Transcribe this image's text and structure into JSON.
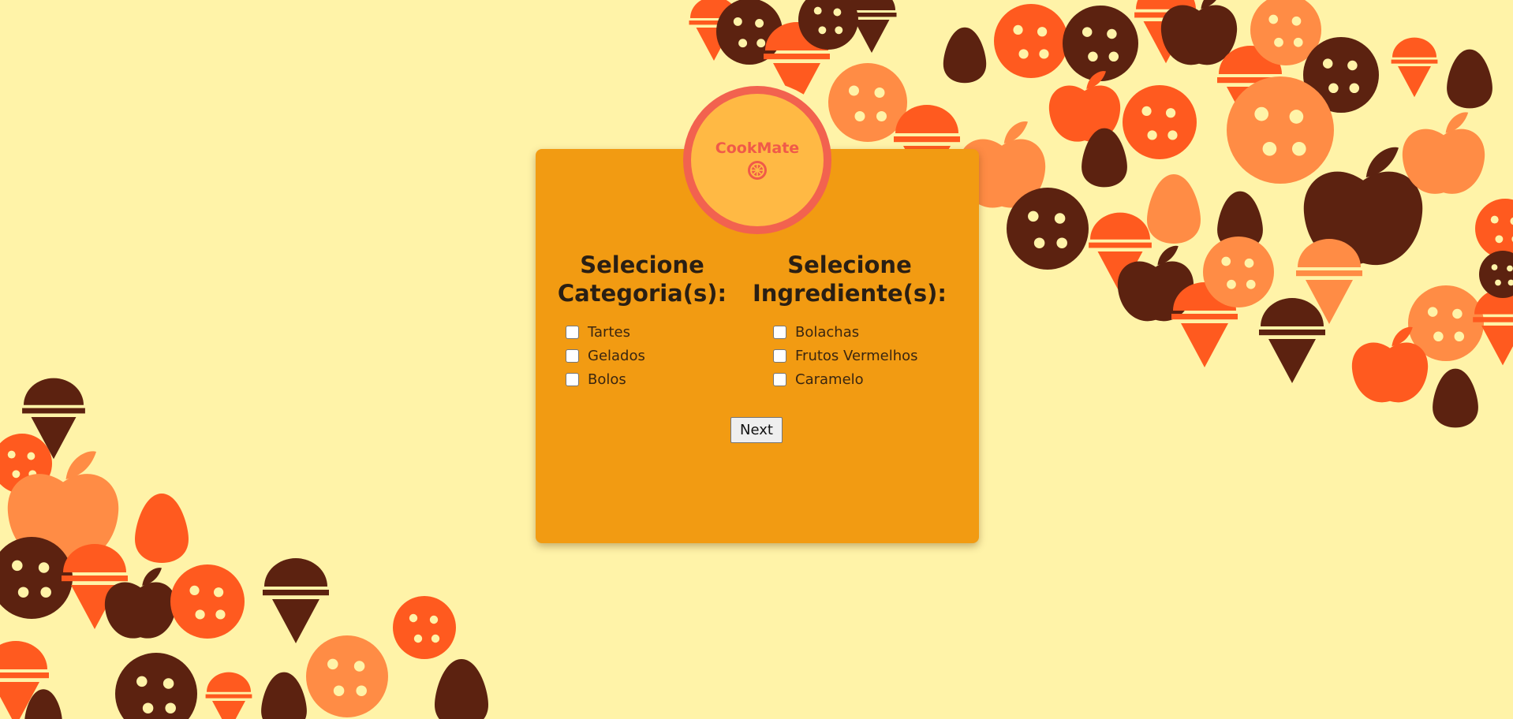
{
  "app": {
    "name": "CookMate"
  },
  "colors": {
    "background": "#fff3a8",
    "card": "#f29b12",
    "logo_fill": "#ffb944",
    "logo_ring": "#f2624f",
    "brown": "#5c2210",
    "red_orange": "#ff5a1f",
    "light_orange": "#ff8c45"
  },
  "logo": {
    "title": "CookMate",
    "icon": "orange-slice-icon"
  },
  "categories": {
    "heading": "Selecione Categoria(s):",
    "options": [
      {
        "label": "Tartes",
        "checked": false
      },
      {
        "label": "Gelados",
        "checked": false
      },
      {
        "label": "Bolos",
        "checked": false
      }
    ]
  },
  "ingredients": {
    "heading": "Selecione Ingrediente(s):",
    "options": [
      {
        "label": "Bolachas",
        "checked": false
      },
      {
        "label": "Frutos Vermelhos",
        "checked": false
      },
      {
        "label": "Caramelo",
        "checked": false
      }
    ]
  },
  "actions": {
    "next_label": "Next"
  },
  "decorations": {
    "icons": [
      "cookie-icon",
      "ice-cream-icon",
      "apple-icon",
      "egg-icon"
    ]
  }
}
